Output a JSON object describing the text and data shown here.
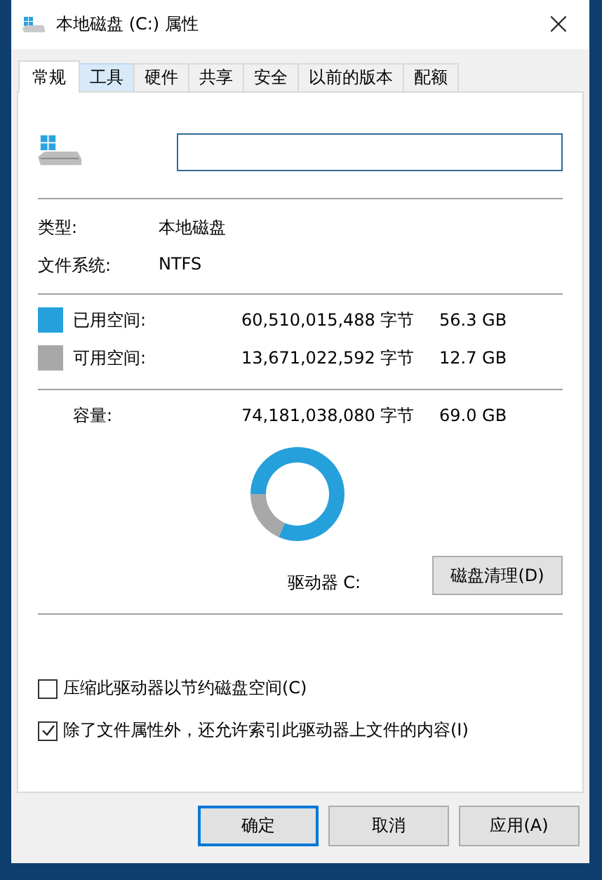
{
  "window": {
    "title": "本地磁盘 (C:) 属性",
    "close": "×"
  },
  "tabs": [
    {
      "label": "常规",
      "selected": true
    },
    {
      "label": "工具",
      "selected": false
    },
    {
      "label": "硬件",
      "selected": false
    },
    {
      "label": "共享",
      "selected": false
    },
    {
      "label": "安全",
      "selected": false
    },
    {
      "label": "以前的版本",
      "selected": false
    },
    {
      "label": "配额",
      "selected": false
    }
  ],
  "info": [
    {
      "label": "类型:",
      "value": "本地磁盘"
    },
    {
      "label": "文件系统:",
      "value": "NTFS"
    }
  ],
  "space": [
    {
      "label": "已用空间:",
      "bytes": "60,510,015,488 字节",
      "size": "56.3 GB",
      "color": "#26a0da"
    },
    {
      "label": "可用空间:",
      "bytes": "13,671,022,592 字节",
      "size": "12.7 GB",
      "color": "#a8a8a8"
    }
  ],
  "capacity": {
    "label": "容量:",
    "bytes": "74,181,038,080 字节",
    "size": "69.0 GB"
  },
  "drive_label": "驱动器 C:",
  "chart_data": {
    "type": "donut",
    "values": [
      81.6,
      18.4
    ]
  },
  "cleanup_button": "磁盘清理(D)",
  "options": [
    {
      "label": "压缩此驱动器以节约磁盘空间(C)",
      "checked": false
    },
    {
      "label": "除了文件属性外，还允许索引此驱动器上文件的内容(I)",
      "checked": true
    }
  ],
  "buttons": [
    {
      "label": "确定",
      "default": true
    },
    {
      "label": "取消",
      "default": false
    },
    {
      "label": "应用(A)",
      "default": false
    }
  ]
}
